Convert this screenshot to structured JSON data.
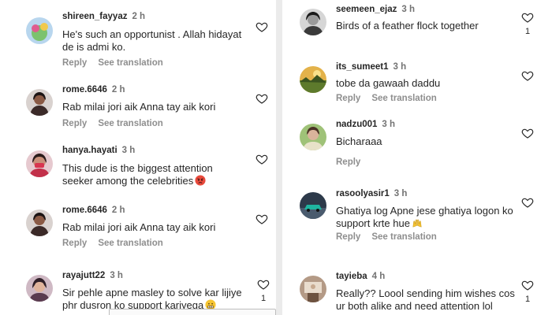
{
  "left": [
    {
      "user": "shireen_fayyaz",
      "time": "2 h",
      "text": [
        "He's such an opportunist . Allah hidayat",
        "de is admi ko."
      ],
      "reply": "Reply",
      "translate": "See translation",
      "avatar": "avatar-colorful-icon"
    },
    {
      "user": "rome.6646",
      "time": "2 h",
      "text": [
        "Rab milai jori aik Anna tay aik kori"
      ],
      "reply": "Reply",
      "translate": "See translation",
      "avatar": "avatar-woman-icon"
    },
    {
      "user": "hanya.hayati",
      "time": "3 h",
      "text": [
        "This dude is the biggest attention",
        "seeker among the celebrities"
      ],
      "emoji": "angry-face",
      "reply": "",
      "translate": "",
      "avatar": "avatar-woman-mask-icon"
    },
    {
      "user": "rome.6646",
      "time": "2 h",
      "text": [
        "Rab milai jori aik Anna tay aik kori"
      ],
      "reply": "Reply",
      "translate": "See translation",
      "avatar": "avatar-woman-icon"
    },
    {
      "user": "rayajutt22",
      "time": "3 h",
      "text": [
        "Sir pehle apne masley to solve kar lijiye",
        "phr dusron ko support kariyega"
      ],
      "emoji": "grimacing-face",
      "likes": "1",
      "avatar": "avatar-girl-icon"
    }
  ],
  "right": [
    {
      "user": "seemeen_ejaz",
      "time": "3 h",
      "text": [
        "Birds of a feather flock together"
      ],
      "likes": "1",
      "avatar": "avatar-bw-icon"
    },
    {
      "user": "its_sumeet1",
      "time": "3 h",
      "text": [
        "tobe da gawaah daddu"
      ],
      "reply": "Reply",
      "translate": "See translation",
      "avatar": "avatar-landscape-icon"
    },
    {
      "user": "nadzu001",
      "time": "3 h",
      "text": [
        "Bicharaaa"
      ],
      "reply": "Reply",
      "avatar": "avatar-green-icon"
    },
    {
      "user": "rasoolyasir1",
      "time": "3 h",
      "text": [
        "Ghatiya log Apne jese ghatiya logon ko",
        "support krte hue"
      ],
      "emoji": "raised-hands",
      "reply": "Reply",
      "translate": "See translation",
      "avatar": "avatar-car-icon"
    },
    {
      "user": "tayieba",
      "time": "4 h",
      "text": [
        "Really?? Loool sending him wishes cos",
        "ur both alike and need attention lol"
      ],
      "likes": "1",
      "avatar": "avatar-room-icon"
    }
  ],
  "colors": {
    "text": "#262626",
    "muted": "#737373",
    "background": "#ffffff"
  }
}
